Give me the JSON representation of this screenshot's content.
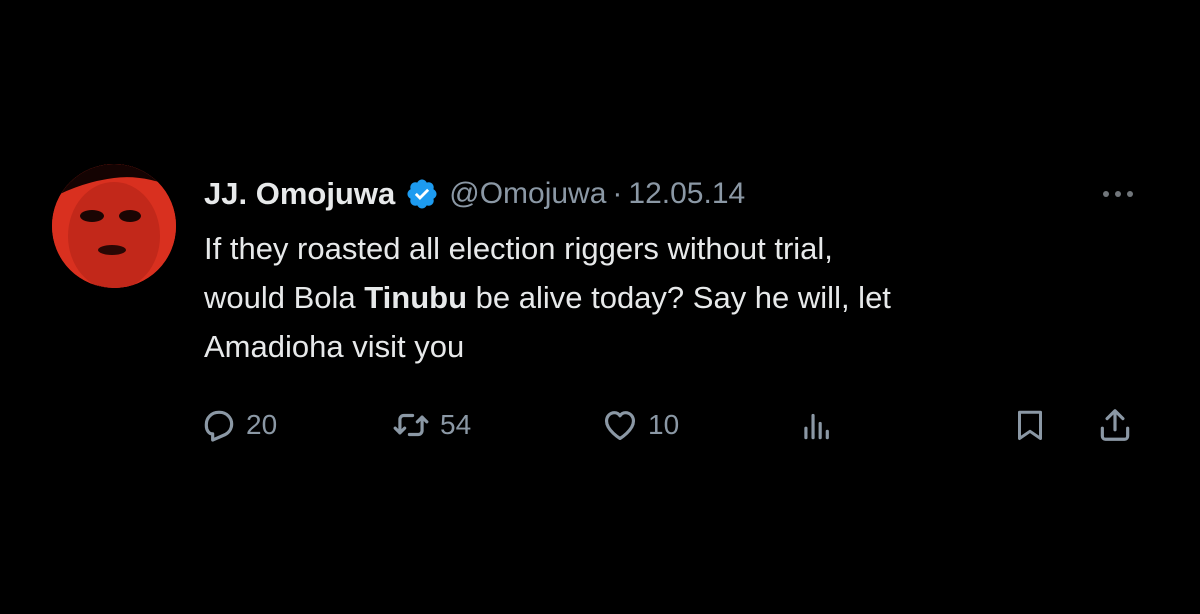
{
  "tweet": {
    "author": {
      "display_name": "JJ. Omojuwa",
      "handle": "@Omojuwa",
      "verified": true
    },
    "separator": "·",
    "date": "12.05.14",
    "text": {
      "line1": "If they roasted all election riggers without trial,",
      "line2_before": "would Bola ",
      "line2_bold": "Tinubu",
      "line2_after": " be alive today? Say he will, let",
      "line3": "Amadioha visit you"
    },
    "metrics": {
      "replies": "20",
      "retweets": "54",
      "likes": "10"
    },
    "icons": {
      "verified": "verified-badge-icon",
      "more": "more-options-icon",
      "reply": "reply-icon",
      "retweet": "retweet-icon",
      "like": "heart-icon",
      "views": "views-chart-icon",
      "bookmark": "bookmark-icon",
      "share": "share-icon"
    },
    "colors": {
      "background": "#000000",
      "primary_text": "#e7e9ea",
      "secondary_text": "#8b98a5",
      "verified_blue": "#1d9bf0",
      "avatar_red": "#d9301f"
    }
  }
}
